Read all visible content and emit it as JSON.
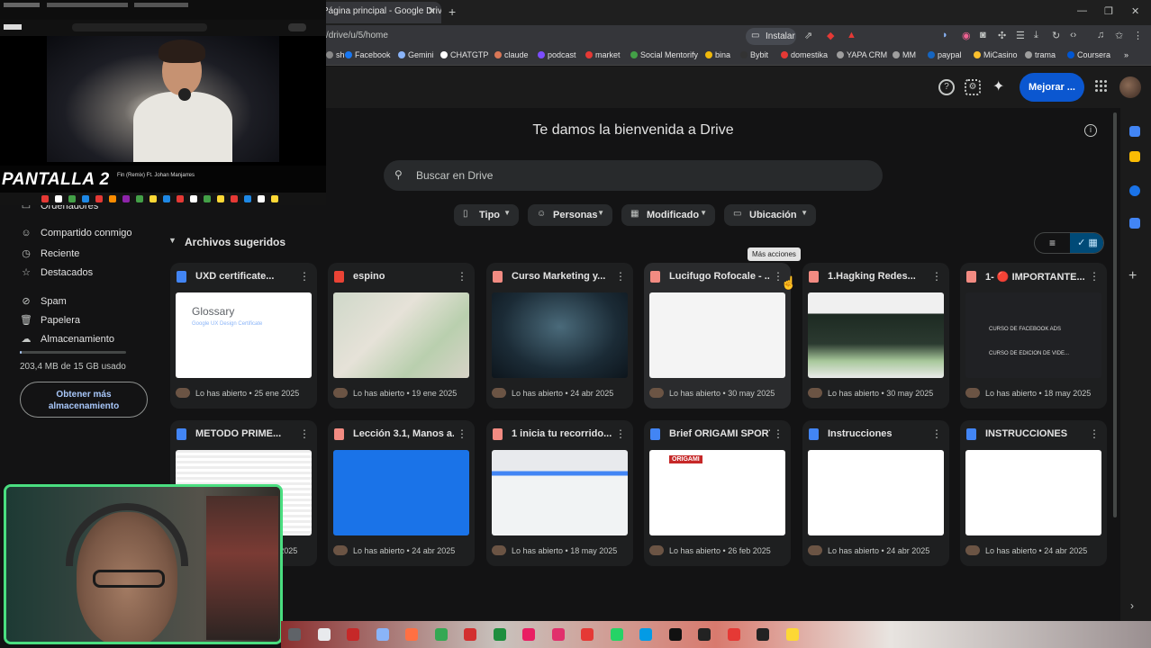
{
  "browser": {
    "tab_title": "Página principal - Google Drive",
    "address": "/drive/u/5/home",
    "install_label": "Instalar",
    "bookmarks": [
      {
        "label": "sh",
        "color": "#888"
      },
      {
        "label": "Facebook",
        "color": "#1877f2"
      },
      {
        "label": "Gemini",
        "color": "#8ab4f8"
      },
      {
        "label": "CHATGTP",
        "color": "#ffffff"
      },
      {
        "label": "claude",
        "color": "#d97757"
      },
      {
        "label": "podcast",
        "color": "#7c4dff"
      },
      {
        "label": "market",
        "color": "#e53935"
      },
      {
        "label": "Social Mentorify",
        "color": "#43a047"
      },
      {
        "label": "bina",
        "color": "#f0b90b"
      },
      {
        "label": "Bybit",
        "color": "#333333"
      },
      {
        "label": "domestika",
        "color": "#e53935"
      },
      {
        "label": "YAPA CRM",
        "color": "#9e9e9e"
      },
      {
        "label": "MM",
        "color": "#9e9e9e"
      },
      {
        "label": "paypal",
        "color": "#1565c0"
      },
      {
        "label": "MiCasino",
        "color": "#fbc02d"
      },
      {
        "label": "trama",
        "color": "#9e9e9e"
      },
      {
        "label": "Coursera",
        "color": "#0056d2"
      }
    ]
  },
  "header": {
    "upgrade_label": "Mejorar ..."
  },
  "main": {
    "welcome": "Te damos la bienvenida a Drive",
    "search_placeholder": "Buscar en Drive",
    "filters": [
      {
        "label": "Tipo",
        "icon": "file-icon"
      },
      {
        "label": "Personas",
        "icon": "person-icon"
      },
      {
        "label": "Modificado",
        "icon": "calendar-icon"
      },
      {
        "label": "Ubicación",
        "icon": "folder-icon"
      }
    ],
    "section_title": "Archivos sugeridos",
    "tooltip": "Más acciones",
    "files": [
      {
        "name": "UXD certificate...",
        "type": "doc",
        "color": "#4285f4",
        "meta": "Lo has abierto • 25 ene 2025",
        "thumb_title": "Glossary",
        "thumb_sub": "Google UX Design Certificate"
      },
      {
        "name": "espino",
        "type": "map",
        "color": "#ea4335",
        "meta": "Lo has abierto • 19 ene 2025"
      },
      {
        "name": "Curso Marketing y...",
        "type": "video",
        "color": "#f28b82",
        "meta": "Lo has abierto • 24 abr 2025"
      },
      {
        "name": "Lucifugo Rofocale - ...",
        "type": "pdf",
        "color": "#f28b82",
        "meta": "Lo has abierto • 30 may 2025"
      },
      {
        "name": "1.Hagking Redes...",
        "type": "video",
        "color": "#f28b82",
        "meta": "Lo has abierto • 30 may 2025"
      },
      {
        "name": "1- 🔴 IMPORTANTE...",
        "type": "video",
        "color": "#f28b82",
        "meta": "Lo has abierto • 18 may 2025",
        "thumb_items": [
          "CURSO DE FACEBOOK ADS",
          "CURSO DE EDICION DE VIDE..."
        ]
      },
      {
        "name": "METODO PRIME...",
        "type": "doc",
        "color": "#4285f4",
        "meta": "Lo has abierto • 24 abr 2025"
      },
      {
        "name": "Lección 3.1, Manos a...",
        "type": "video",
        "color": "#f28b82",
        "meta": "Lo has abierto • 24 abr 2025"
      },
      {
        "name": "1 inicia tu recorrido...",
        "type": "video",
        "color": "#f28b82",
        "meta": "Lo has abierto • 18 may 2025"
      },
      {
        "name": "Brief ORIGAMI SPORT",
        "type": "doc",
        "color": "#4285f4",
        "meta": "Lo has abierto • 26 feb 2025",
        "thumb_title": "ORIGAMI"
      },
      {
        "name": "Instrucciones",
        "type": "doc",
        "color": "#4285f4",
        "meta": "Lo has abierto • 24 abr 2025"
      },
      {
        "name": "INSTRUCCIONES",
        "type": "doc",
        "color": "#4285f4",
        "meta": "Lo has abierto • 24 abr 2025"
      }
    ]
  },
  "sidebar": {
    "items": [
      {
        "label": "Ordenadores",
        "icon": "computer-icon"
      },
      {
        "label": "Compartido conmigo",
        "icon": "people-icon"
      },
      {
        "label": "Reciente",
        "icon": "clock-icon"
      },
      {
        "label": "Destacados",
        "icon": "star-icon"
      },
      {
        "label": "Spam",
        "icon": "spam-icon"
      },
      {
        "label": "Papelera",
        "icon": "trash-icon"
      },
      {
        "label": "Almacenamiento",
        "icon": "cloud-icon"
      }
    ],
    "storage_text": "203,4 MB de 15 GB usado",
    "storage_fraction": 0.013,
    "storage_button": "Obtener más almacenamiento"
  },
  "overlay": {
    "label": "PANTALLA 2",
    "song_title": "Fin (Remix) Ft. Johan Manjarres"
  }
}
